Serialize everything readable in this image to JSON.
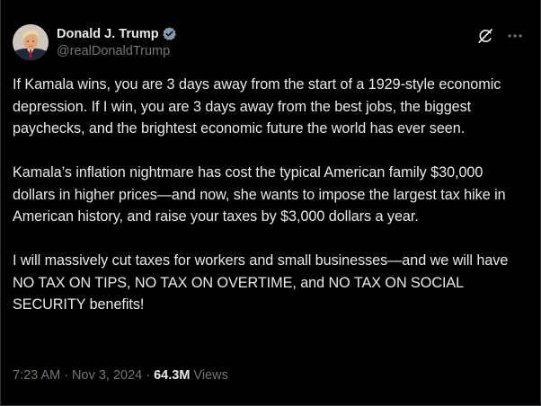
{
  "author": {
    "display_name": "Donald J. Trump",
    "handle": "@realDonaldTrump",
    "verified": true,
    "verified_color": "#829aab"
  },
  "icons": {
    "grok": "grok-icon",
    "more": "more-options-icon",
    "verified": "verified-badge-icon"
  },
  "tweet": {
    "paragraphs": [
      "If Kamala wins, you are 3 days away from the start of a 1929-style economic depression. If I win, you are 3 days away from the best jobs, the biggest paychecks, and the brightest economic future the world has ever seen.",
      "Kamala’s inflation nightmare has cost the typical American family $30,000 dollars in higher prices—and now, she wants to impose the largest tax hike in American history, and raise your taxes by $3,000 dollars a year.",
      "I will massively cut taxes for workers and small businesses—and we will have NO TAX ON TIPS, NO TAX ON OVERTIME, and NO TAX ON SOCIAL SECURITY benefits!"
    ],
    "time": "7:23 AM",
    "date": "Nov 3, 2024",
    "separator": "·",
    "views_count": "64.3M",
    "views_label": "Views"
  },
  "colors": {
    "background": "#000000",
    "text_primary": "#e7e9ea",
    "text_secondary": "#71767b"
  }
}
